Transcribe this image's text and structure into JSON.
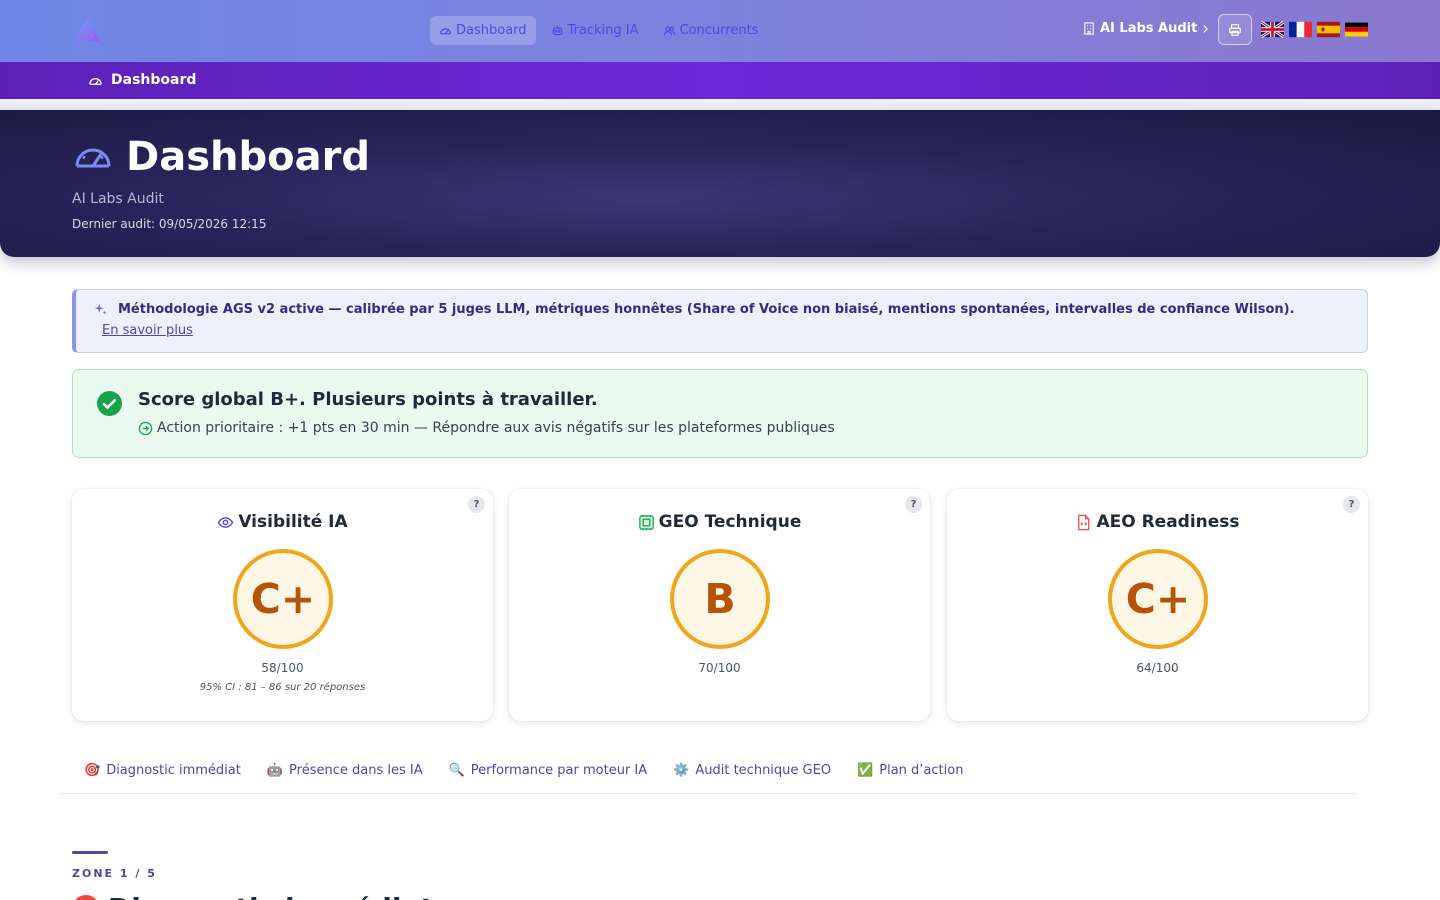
{
  "nav": {
    "logo": "app-logo",
    "links": [
      {
        "label": "Dashboard",
        "icon": "gauge-icon",
        "active": true
      },
      {
        "label": "Tracking IA",
        "icon": "robot-icon",
        "active": false
      },
      {
        "label": "Concurrents",
        "icon": "users-icon",
        "active": false
      }
    ],
    "org_name": "AI Labs Audit",
    "print_icon": "printer-icon",
    "languages": [
      "en",
      "fr",
      "es",
      "de"
    ]
  },
  "breadcrumb": {
    "label": "Dashboard"
  },
  "hero": {
    "title": "Dashboard",
    "subtitle": "AI Labs Audit",
    "last_audit": "Dernier audit: 09/05/2026 12:15"
  },
  "methodology": {
    "text": "Méthodologie AGS v2 active — calibrée par 5 juges LLM, métriques honnêtes (Share of Voice non biaisé, mentions spontanées, intervalles de confiance Wilson).",
    "link": "En savoir plus"
  },
  "score_banner": {
    "title": "Score global B+. Plusieurs points à travailler.",
    "action": "Action prioritaire : +1 pts en 30 min — Répondre aux avis négatifs sur les plateformes publiques"
  },
  "cards": [
    {
      "title": "Visibilité IA",
      "icon": "eye-icon",
      "grade": "C+",
      "score": "58/100",
      "ci": "95% CI : 81 – 86   sur 20 réponses",
      "help": "?"
    },
    {
      "title": "GEO Technique",
      "icon": "chip-icon",
      "grade": "B",
      "score": "70/100",
      "ci": "",
      "help": "?"
    },
    {
      "title": "AEO Readiness",
      "icon": "code-file-icon",
      "grade": "C+",
      "score": "64/100",
      "ci": "",
      "help": "?"
    }
  ],
  "tabs": [
    {
      "emoji": "🎯",
      "label": "Diagnostic immédiat"
    },
    {
      "emoji": "🤖",
      "label": "Présence dans les IA"
    },
    {
      "emoji": "🔍",
      "label": "Performance par moteur IA"
    },
    {
      "emoji": "⚙️",
      "label": "Audit technique GEO"
    },
    {
      "emoji": "✅",
      "label": "Plan d’action"
    }
  ],
  "zone": {
    "label": "ZONE 1 / 5",
    "title": "Diagnostic immédiat"
  },
  "colors": {
    "accent": "#4f46a5",
    "grade_ring": "#f1a51c",
    "grade_text": "#b45309",
    "success": "#16a34a"
  }
}
